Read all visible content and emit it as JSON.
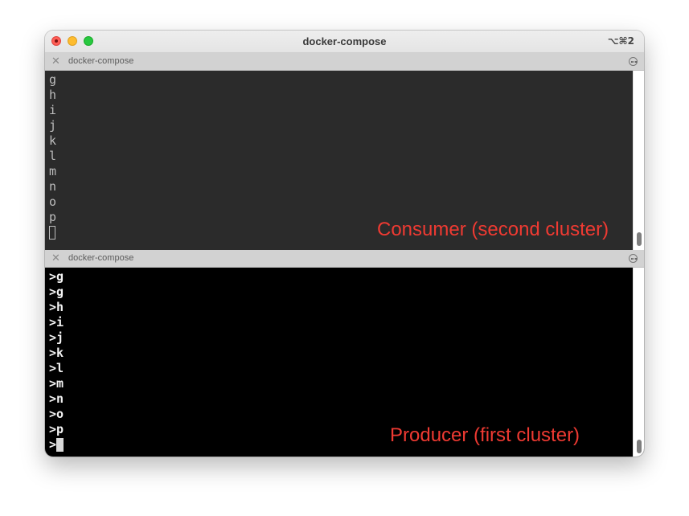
{
  "window": {
    "title": "docker-compose",
    "shortcut": "⌥⌘2"
  },
  "panes": [
    {
      "tab_label": "docker-compose",
      "lines": [
        "g",
        "h",
        "i",
        "j",
        "k",
        "l",
        "m",
        "n",
        "o",
        "p"
      ],
      "annotation": "Consumer (second cluster)"
    },
    {
      "tab_label": "docker-compose",
      "lines": [
        ">g",
        ">g",
        ">h",
        ">i",
        ">j",
        ">k",
        ">l",
        ">m",
        ">n",
        ">o",
        ">p"
      ],
      "prompt": ">",
      "annotation": "Producer (first cluster)"
    }
  ],
  "icons": {
    "tab_close": "close-icon",
    "tab_more": "more-options-icon"
  },
  "colors": {
    "annotation": "#ef3a32",
    "top_terminal_bg": "#2b2b2b",
    "bottom_terminal_bg": "#000000"
  }
}
